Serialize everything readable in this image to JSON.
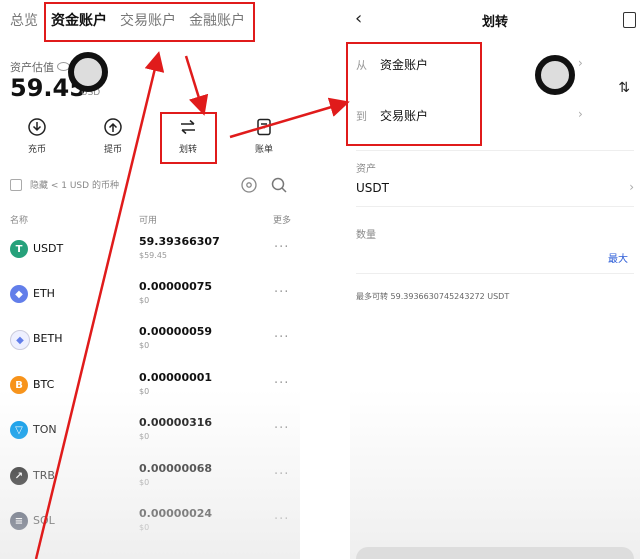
{
  "left": {
    "tabs": [
      "总览",
      "资金账户",
      "交易账户",
      "金融账户"
    ],
    "asset_label": "资产估值",
    "total_value": "59.45",
    "total_unit": "USD",
    "actions": [
      {
        "label": "充币",
        "icon": "deposit-icon"
      },
      {
        "label": "提币",
        "icon": "withdraw-icon"
      },
      {
        "label": "划转",
        "icon": "transfer-icon"
      },
      {
        "label": "账单",
        "icon": "bill-icon"
      }
    ],
    "hide_small_label": "隐藏 < 1 USD 的币种",
    "columns": {
      "name": "名称",
      "available": "可用",
      "more": "更多"
    },
    "assets": [
      {
        "symbol": "USDT",
        "amount": "59.39366307",
        "usd": "$59.45",
        "color": "#26a17b",
        "icon": "usdt-icon"
      },
      {
        "symbol": "ETH",
        "amount": "0.00000075",
        "usd": "$0",
        "color": "#627eea",
        "icon": "eth-icon"
      },
      {
        "symbol": "BETH",
        "amount": "0.00000059",
        "usd": "$0",
        "color": "#eef0ff",
        "icon": "beth-icon"
      },
      {
        "symbol": "BTC",
        "amount": "0.00000001",
        "usd": "$0",
        "color": "#f7931a",
        "icon": "btc-icon"
      },
      {
        "symbol": "TON",
        "amount": "0.00000316",
        "usd": "$0",
        "color": "#0098ea",
        "icon": "ton-icon"
      },
      {
        "symbol": "TRB",
        "amount": "0.00000068",
        "usd": "$0",
        "color": "#111111",
        "icon": "trb-icon"
      },
      {
        "symbol": "SOL",
        "amount": "0.00000024",
        "usd": "$0",
        "color": "#1f2a44",
        "icon": "sol-icon"
      }
    ]
  },
  "right": {
    "title": "划转",
    "from_label": "从",
    "from_value": "资金账户",
    "to_label": "到",
    "to_value": "交易账户",
    "asset_label": "资产",
    "asset_value": "USDT",
    "amount_label": "数量",
    "max_label": "最大",
    "max_transfer_label": "最多可转",
    "max_transfer_value": "59.3936630745243272 USDT"
  },
  "colors": {
    "highlight": "#e01b1b",
    "accent": "#2a5bd7"
  }
}
